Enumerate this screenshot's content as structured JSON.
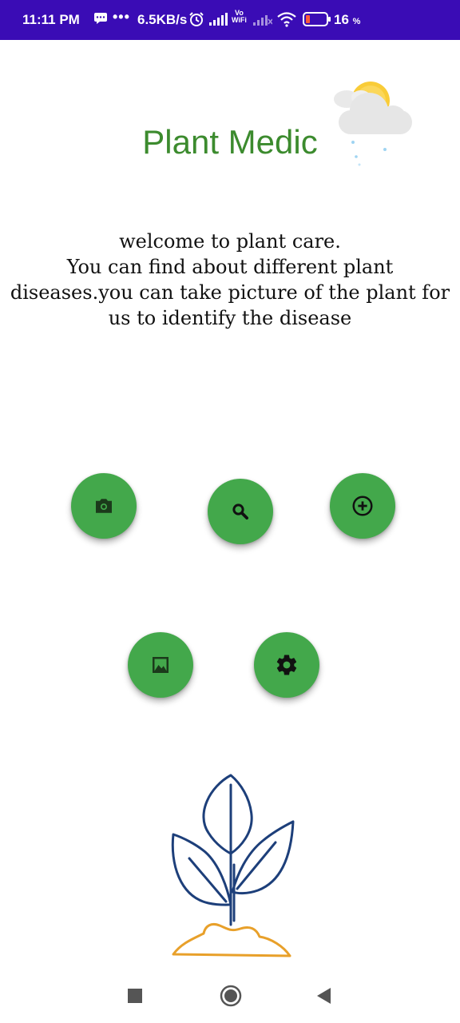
{
  "status_bar": {
    "time": "11:11 PM",
    "dots": "•••",
    "speed": "6.5KB/s",
    "vowifi_line1": "Vo",
    "vowifi_line2": "WiFi",
    "battery": "16",
    "battery_unit": "%"
  },
  "header": {
    "title": "Plant Medic"
  },
  "welcome_text": "welcome to plant care.\n      You can find about different plant\ndiseases.you can take picture of the plant for\nus to identify the disease",
  "actions": [
    {
      "name": "camera",
      "icon": "camera-icon"
    },
    {
      "name": "search",
      "icon": "search-icon"
    },
    {
      "name": "add",
      "icon": "add-circle-icon"
    },
    {
      "name": "gallery",
      "icon": "image-icon"
    },
    {
      "name": "settings",
      "icon": "gear-icon"
    }
  ],
  "colors": {
    "status_bar": "#3a0cb5",
    "title": "#3c8b2e",
    "fab": "#43a84b",
    "plant_stroke": "#1d3f7a",
    "soil_stroke": "#e8a02a"
  }
}
